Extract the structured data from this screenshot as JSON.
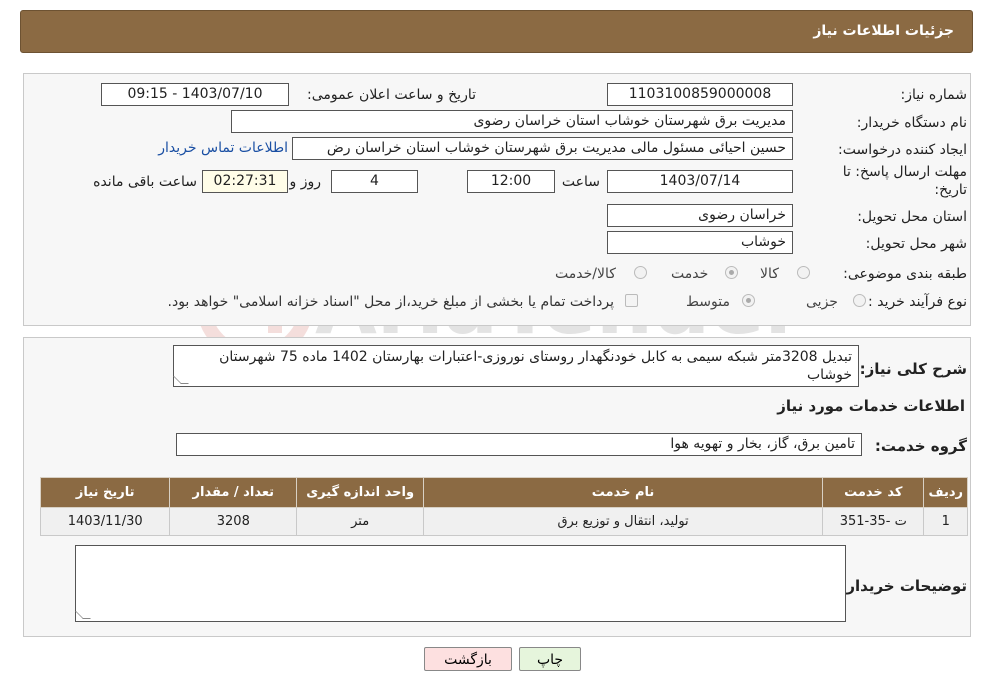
{
  "header": {
    "title": "جزئیات اطلاعات نیاز"
  },
  "form": {
    "need_number_label": "شماره نیاز:",
    "need_number": "1103100859000008",
    "announce_label": "تاریخ و ساعت اعلان عمومی:",
    "announce_value": "1403/07/10 - 09:15",
    "buyer_org_label": "نام دستگاه خریدار:",
    "buyer_org": "مدیریت برق شهرستان خوشاب استان خراسان رضوی",
    "requester_label": "ایجاد کننده درخواست:",
    "requester": "حسین احیائی مسئول مالی مدیریت برق شهرستان خوشاب استان خراسان رض",
    "contact_link": "اطلاعات تماس خریدار",
    "deadline_label_1": "مهلت ارسال پاسخ: تا",
    "deadline_label_2": "تاریخ:",
    "deadline_date": "1403/07/14",
    "time_label": "ساعت",
    "deadline_time": "12:00",
    "days_value": "4",
    "days_label": "روز و",
    "remaining_value": "02:27:31",
    "remaining_label": "ساعت باقی مانده",
    "province_label": "استان محل تحویل:",
    "province": "خراسان رضوی",
    "city_label": "شهر محل تحویل:",
    "city": "خوشاب",
    "category_label": "طبقه بندی موضوعی:",
    "category_options": [
      "کالا",
      "خدمت",
      "کالا/خدمت"
    ],
    "category_selected": "خدمت",
    "process_label": "نوع فرآیند خرید :",
    "process_options": [
      "جزیی",
      "متوسط"
    ],
    "process_selected": "متوسط",
    "payment_note": "پرداخت تمام یا بخشی از مبلغ خرید،از محل \"اسناد خزانه اسلامی\" خواهد بود."
  },
  "summary": {
    "label": "شرح کلی نیاز:",
    "text": "تبدیل 3208متر شبکه سیمی به کابل خودنگهدار روستای نوروزی-اعتبارات بهارستان 1402 ماده 75 شهرستان خوشاب"
  },
  "services": {
    "section_title": "اطلاعات خدمات مورد نیاز",
    "group_label": "گروه خدمت:",
    "group_value": "تامین برق، گاز، بخار و تهویه هوا",
    "columns": [
      "ردیف",
      "کد خدمت",
      "نام خدمت",
      "واحد اندازه گیری",
      "تعداد / مقدار",
      "تاریخ نیاز"
    ],
    "rows": [
      [
        "1",
        "ت -35-351",
        "تولید، انتقال و توزیع برق",
        "متر",
        "3208",
        "1403/11/30"
      ]
    ]
  },
  "buyer_notes": {
    "label": "توضیحات خریدار:",
    "text": ""
  },
  "buttons": {
    "print": "چاپ",
    "back": "بازگشت"
  },
  "colors": {
    "header_bg": "#8b6a43",
    "link": "#1a4fa3",
    "back_button_bg": "#fde0e0",
    "print_button_bg": "#e6f5dc"
  }
}
